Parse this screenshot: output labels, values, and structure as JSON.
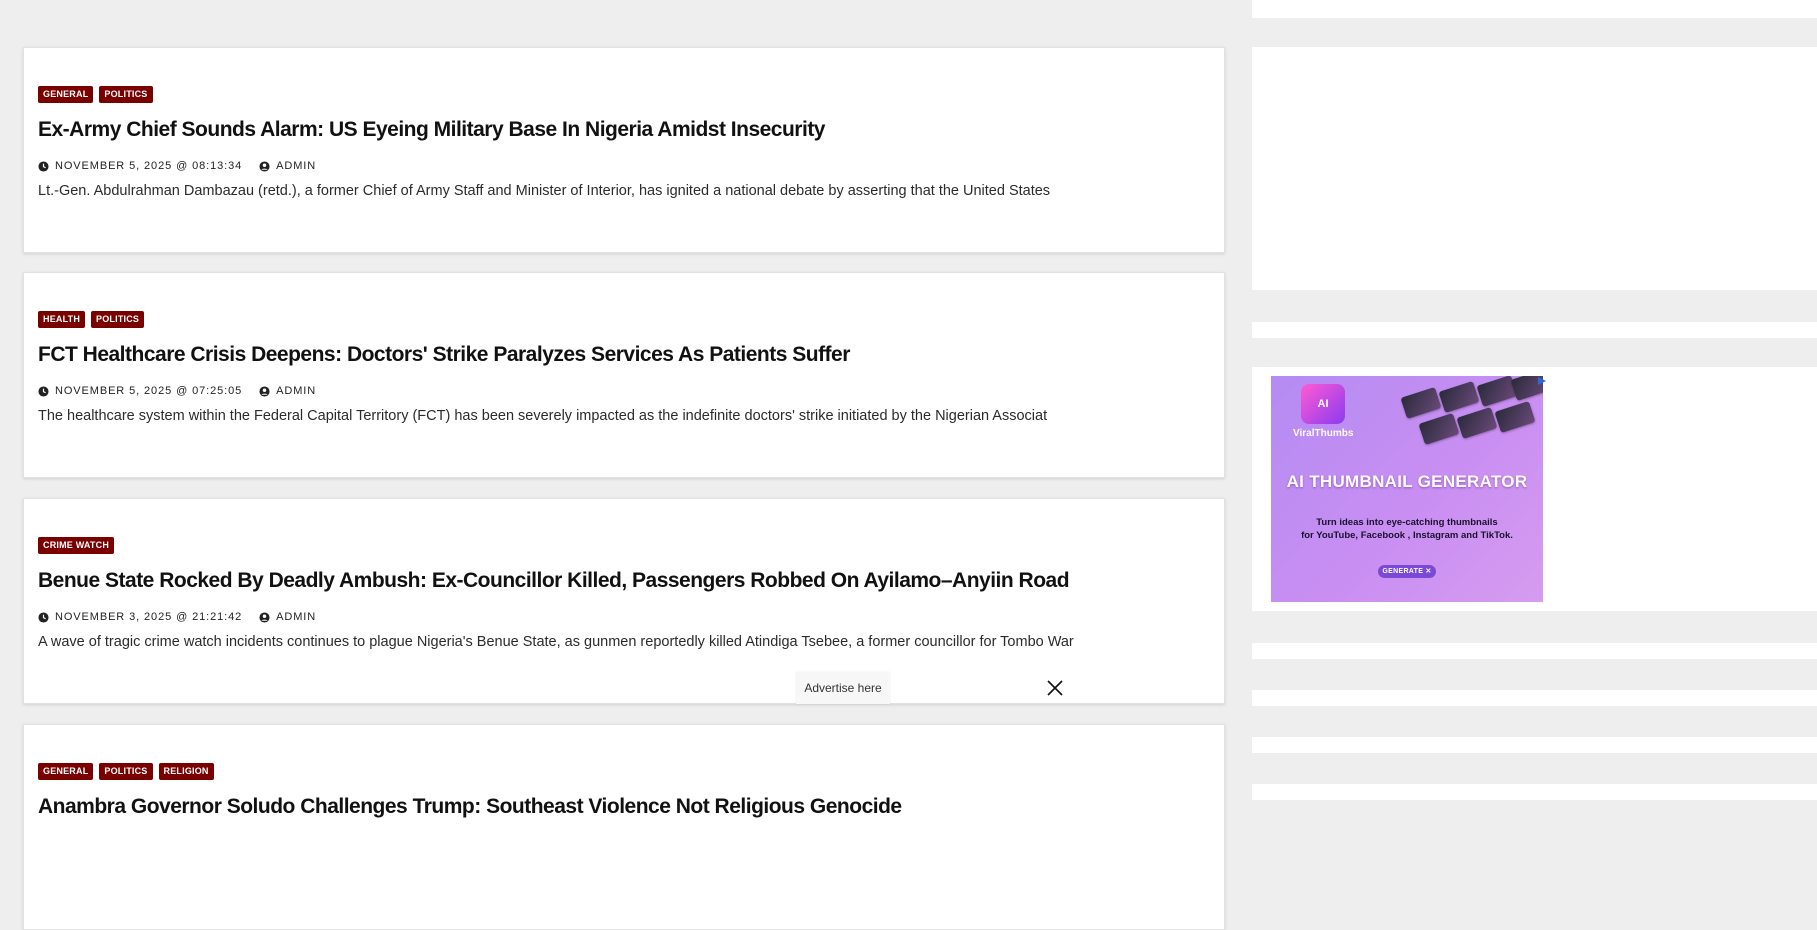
{
  "posts": [
    {
      "categories": [
        "GENERAL",
        "POLITICS"
      ],
      "title": "Ex-Army Chief Sounds Alarm: US Eyeing Military Base In Nigeria Amidst Insecurity",
      "date": "NOVEMBER 5, 2025 @ 08:13:34",
      "author": "ADMIN",
      "excerpt": "Lt.-Gen. Abdulrahman Dambazau (retd.), a former Chief of Army Staff and Minister of Interior, has ignited a national debate by asserting that the United States"
    },
    {
      "categories": [
        "HEALTH",
        "POLITICS"
      ],
      "title": "FCT Healthcare Crisis Deepens: Doctors' Strike Paralyzes Services As Patients Suffer",
      "date": "NOVEMBER 5, 2025 @ 07:25:05",
      "author": "ADMIN",
      "excerpt": "The healthcare system within the Federal Capital Territory (FCT) has been severely impacted as the indefinite doctors' strike initiated by the Nigerian Associat"
    },
    {
      "categories": [
        "CRIME WATCH"
      ],
      "title": "Benue State Rocked By Deadly Ambush: Ex-Councillor Killed, Passengers Robbed On Ayilamo–Anyiin Road",
      "date": "NOVEMBER 3, 2025 @ 21:21:42",
      "author": "ADMIN",
      "excerpt": "A wave of tragic crime watch incidents continues to plague Nigeria's Benue State, as gunmen reportedly killed Atindiga Tsebee, a former councillor for Tombo War"
    },
    {
      "categories": [
        "GENERAL",
        "POLITICS",
        "RELIGION"
      ],
      "title": "Anambra Governor Soludo Challenges Trump: Southeast Violence Not Religious Genocide",
      "date": "",
      "author": "",
      "excerpt": ""
    }
  ],
  "ad": {
    "brand": "ViralThumbs",
    "logo_text": "AI",
    "headline": "AI THUMBNAIL GENERATOR",
    "subtext_line1": "Turn ideas into eye-catching thumbnails",
    "subtext_line2": "for YouTube, Facebook , Instagram and TikTok.",
    "button": "GENERATE ✕"
  },
  "overlay": {
    "advertise_label": "Advertise here",
    "close_icon": "close-icon"
  },
  "colors": {
    "category_bg": "#7a0000",
    "page_bg": "#eeeeee",
    "ad_gradient_start": "#b48cf3"
  }
}
